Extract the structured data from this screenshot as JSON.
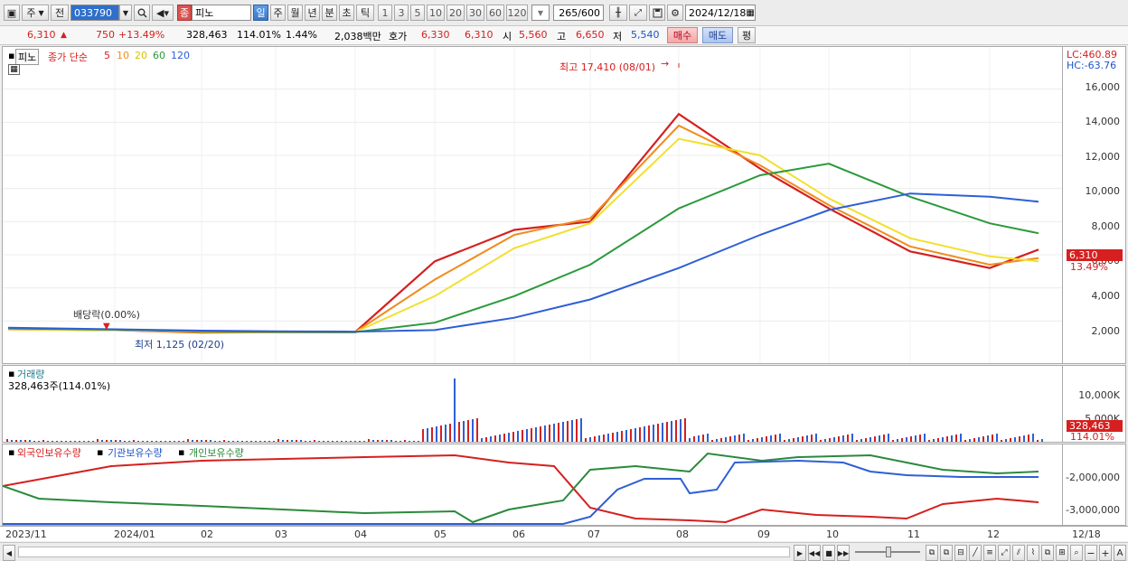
{
  "toolbar": {
    "period_label": "주",
    "prev_label": "전",
    "code": "033790",
    "badge": "종",
    "name": "피노",
    "tf_buttons": [
      "일",
      "주",
      "월",
      "년",
      "분",
      "초",
      "틱"
    ],
    "num_buttons": [
      "1",
      "3",
      "5",
      "10",
      "20",
      "30",
      "60",
      "120"
    ],
    "count": "265",
    "count_max": "/600",
    "date": "2024/12/18"
  },
  "quote": {
    "price": "6,310",
    "change": "750",
    "change_pct": "+13.49%",
    "volume": "328,463",
    "volume_ratio": "114.01%",
    "turnover": "1.44%",
    "amount": "2,038백만",
    "bid_label": "호가",
    "ask_price": "6,330",
    "bid_price": "6,310",
    "open_label": "시",
    "open": "5,560",
    "high_label": "고",
    "high": "6,650",
    "low_label": "저",
    "low": "5,540",
    "buy_label": "매수",
    "sell_label": "매도",
    "avg_label": "평"
  },
  "price_panel": {
    "tag": "피노",
    "ma_title": "종가 단순",
    "ma_periods": [
      "5",
      "10",
      "20",
      "60",
      "120"
    ],
    "ma_colors": [
      "#d5201f",
      "#f08c1e",
      "#f2e02c",
      "#2a9a3b",
      "#2e5fd6"
    ],
    "lc": "LC:460.89",
    "hc": "HC:-63.76",
    "high_note": "최고 17,410 (08/01)",
    "low_note": "최저 1,125 (02/20)",
    "dividend_note": "배당락(0.00%)",
    "current_price": "6,310",
    "current_pct": "13.49%",
    "y_ticks": [
      "16,000",
      "14,000",
      "12,000",
      "10,000",
      "8,000",
      "6,000",
      "4,000",
      "2,000"
    ]
  },
  "volume_panel": {
    "title": "거래량",
    "value": "328,463주(114.01%)",
    "ticks": [
      "10,000K",
      "5,000K"
    ],
    "current": "328,463",
    "current_pct": "114.01%"
  },
  "holding_panel": {
    "series": [
      "외국인보유수량",
      "기관보유수량",
      "개인보유수량"
    ],
    "ticks": [
      "-2,000,000",
      "-3,000,000"
    ]
  },
  "x_axis": [
    "2023/11",
    "2024/01",
    "02",
    "03",
    "04",
    "05",
    "06",
    "07",
    "08",
    "09",
    "10",
    "11",
    "12",
    "12/18"
  ],
  "chart_data": {
    "type": "line",
    "title": "",
    "ylabel": "",
    "ylim": [
      0,
      17410
    ],
    "x": [
      "2023/11",
      "2024/01",
      "02",
      "03",
      "04",
      "05",
      "06",
      "07",
      "08",
      "09",
      "10",
      "11",
      "12",
      "12/18"
    ],
    "series": [
      {
        "name": "5",
        "values": [
          1500,
          1450,
          1300,
          1320,
          1330,
          5600,
          7500,
          8000,
          14500,
          11200,
          8800,
          6200,
          5200,
          6310
        ]
      },
      {
        "name": "10",
        "values": [
          1500,
          1450,
          1320,
          1320,
          1330,
          4500,
          7200,
          8200,
          13800,
          11400,
          9000,
          6500,
          5400,
          5800
        ]
      },
      {
        "name": "20",
        "values": [
          1500,
          1450,
          1350,
          1320,
          1330,
          3500,
          6400,
          7900,
          13000,
          12000,
          9400,
          7000,
          5900,
          5600
        ]
      },
      {
        "name": "60",
        "values": [
          1550,
          1480,
          1380,
          1340,
          1330,
          1900,
          3500,
          5400,
          8800,
          10800,
          11500,
          9500,
          7900,
          7300
        ]
      },
      {
        "name": "120",
        "values": [
          1600,
          1500,
          1420,
          1380,
          1360,
          1450,
          2200,
          3300,
          5200,
          7200,
          8700,
          9700,
          9500,
          9200
        ]
      }
    ]
  }
}
